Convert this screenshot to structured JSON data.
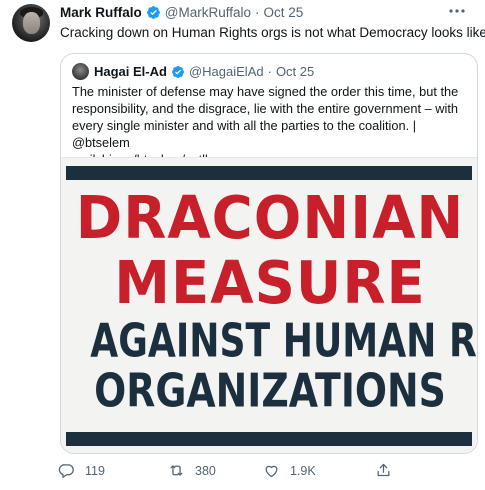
{
  "tweet": {
    "author_name": "Mark Ruffalo",
    "author_handle": "@MarkRuffalo",
    "separator": "·",
    "time": "Oct 25",
    "text": "Cracking down on Human Rights orgs is not what Democracy looks like."
  },
  "quoted": {
    "author_name": "Hagai El-Ad",
    "author_handle": "@HagaiElAd",
    "separator": "·",
    "time": "Oct 25",
    "text_lines": [
      "The minister of defense may have signed the order this time, but the",
      "responsibility, and the disgrace, lie with the entire government – with",
      "every single minister and with all the parties to the coalition. | @btselem",
      "mailchi.mp/btselem/setlle…"
    ]
  },
  "media": {
    "lines": [
      "DRACONIAN",
      "MEASURE",
      "AGAINST HUMAN RIGHTS",
      "ORGANIZATIONS"
    ],
    "colors": {
      "red": "#c8202a",
      "navy": "#1c2f3f",
      "background": "#f3f4f1"
    }
  },
  "actions": {
    "reply_count": "119",
    "retweet_count": "380",
    "like_count": "1.9K"
  },
  "icons": {
    "verified": "verified-badge-icon",
    "more": "more-icon",
    "reply": "reply-icon",
    "retweet": "retweet-icon",
    "like": "heart-icon",
    "share": "share-icon"
  },
  "colors": {
    "verified_blue": "#1d9bf0",
    "text": "#0f1419",
    "secondary": "#536471",
    "border": "#cfd9de"
  }
}
